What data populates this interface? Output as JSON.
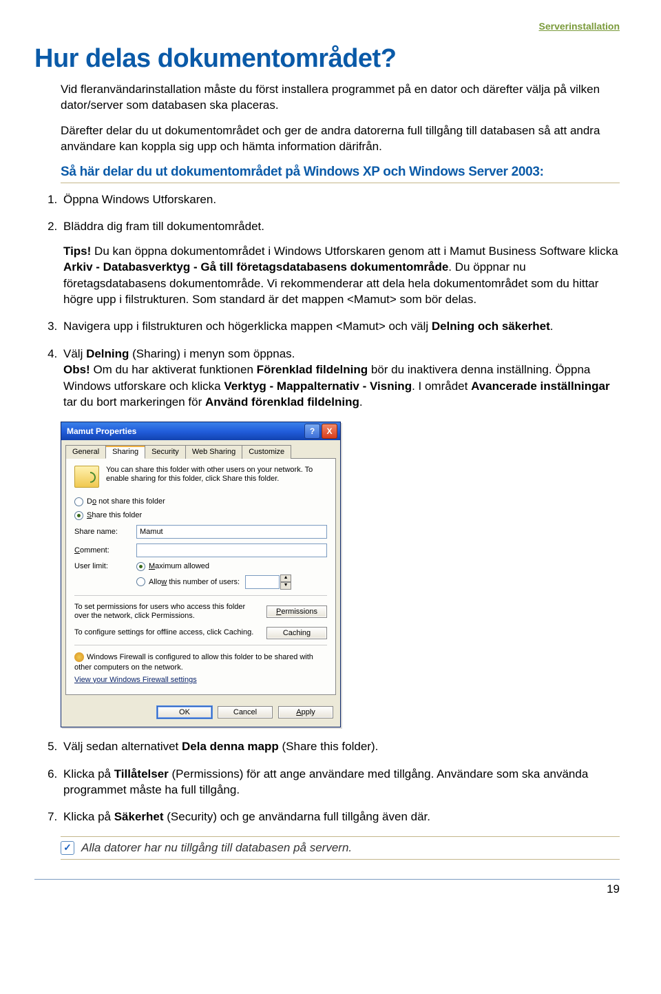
{
  "breadcrumb": "Serverinstallation",
  "title": "Hur delas dokumentområdet?",
  "intro1": "Vid fleranvändarinstallation måste du först installera programmet på en dator och därefter välja på vilken dator/server som databasen ska placeras.",
  "intro2": "Därefter delar du ut dokumentområdet och ger de andra datorerna full tillgång till databasen så att andra användare kan koppla sig upp och hämta information därifrån.",
  "subhead": "Så här delar du ut dokumentområdet på Windows XP och Windows Server 2003:",
  "steps": {
    "s1": "Öppna Windows Utforskaren.",
    "s2": "Bläddra dig fram till dokumentområdet.",
    "tips_label": "Tips!",
    "tips_body": " Du kan öppna dokumentområdet i Windows Utforskaren genom att i Mamut Business Software klicka ",
    "tips_bold1": "Arkiv - Databasverktyg - Gå till företagsdatabasens dokumentområde",
    "tips_body2": ". Du öppnar nu företagsdatabasens dokumentområde. Vi rekommenderar att dela hela dokumentområdet som du hittar högre upp i filstrukturen. Som standard är det mappen <Mamut> som bör delas.",
    "s3a": "Navigera upp i filstrukturen och högerklicka mappen <Mamut> och välj ",
    "s3b": "Delning och säkerhet",
    "s3c": ".",
    "s4a": "Välj ",
    "s4b": "Delning",
    "s4c": " (Sharing) i menyn som öppnas.",
    "s4_obs_label": "Obs!",
    "s4_obs1": " Om du har aktiverat funktionen ",
    "s4_obs_b1": "Förenklad fildelning",
    "s4_obs2": " bör du inaktivera denna inställning. Öppna Windows utforskare och klicka ",
    "s4_obs_b2": "Verktyg - Mappalternativ - Visning",
    "s4_obs3": ". I området ",
    "s4_obs_b3": "Avancerade inställningar",
    "s4_obs4": " tar du bort markeringen för ",
    "s4_obs_b4": "Använd förenklad fildelning",
    "s4_obs5": ".",
    "s5a": "Välj sedan alternativet ",
    "s5b": "Dela denna mapp",
    "s5c": " (Share this folder).",
    "s6a": "Klicka på ",
    "s6b": "Tillåtelser",
    "s6c": " (Permissions) för att ange användare med tillgång. Användare som ska använda programmet måste ha full tillgång.",
    "s7a": "Klicka på ",
    "s7b": "Säkerhet",
    "s7c": " (Security) och ge användarna full tillgång även där."
  },
  "dialog": {
    "title": "Mamut Properties",
    "help": "?",
    "close": "X",
    "tabs": {
      "general": "General",
      "sharing": "Sharing",
      "security": "Security",
      "websharing": "Web Sharing",
      "customize": "Customize"
    },
    "info": "You can share this folder with other users on your network. To enable sharing for this folder, click Share this folder.",
    "opt_donotshare_pre": "D",
    "opt_donotshare_u": "o",
    "opt_donotshare_post": " not share this folder",
    "opt_share_u": "S",
    "opt_share_post": "hare this folder",
    "lbl_sharename": "Share name:",
    "val_sharename": "Mamut",
    "lbl_comment_u": "C",
    "lbl_comment_post": "omment:",
    "lbl_userlimit": "User limit:",
    "opt_max_u": "M",
    "opt_max_post": "aximum allowed",
    "opt_allow_pre": "Allo",
    "opt_allow_u": "w",
    "opt_allow_post": " this number of users:",
    "perm_text": "To set permissions for users who access this folder over the network, click Permissions.",
    "btn_permissions_u": "P",
    "btn_permissions_post": "ermissions",
    "cache_text": "To configure settings for offline access, click Caching.",
    "btn_caching": "Caching",
    "fw_text": "Windows Firewall is configured to allow this folder to be shared with other computers on the network.",
    "fw_link": "View your Windows Firewall settings",
    "btn_ok": "OK",
    "btn_cancel": "Cancel",
    "btn_apply_u": "A",
    "btn_apply_post": "pply"
  },
  "finalnote": "Alla datorer har nu tillgång till databasen på servern.",
  "pagenum": "19"
}
